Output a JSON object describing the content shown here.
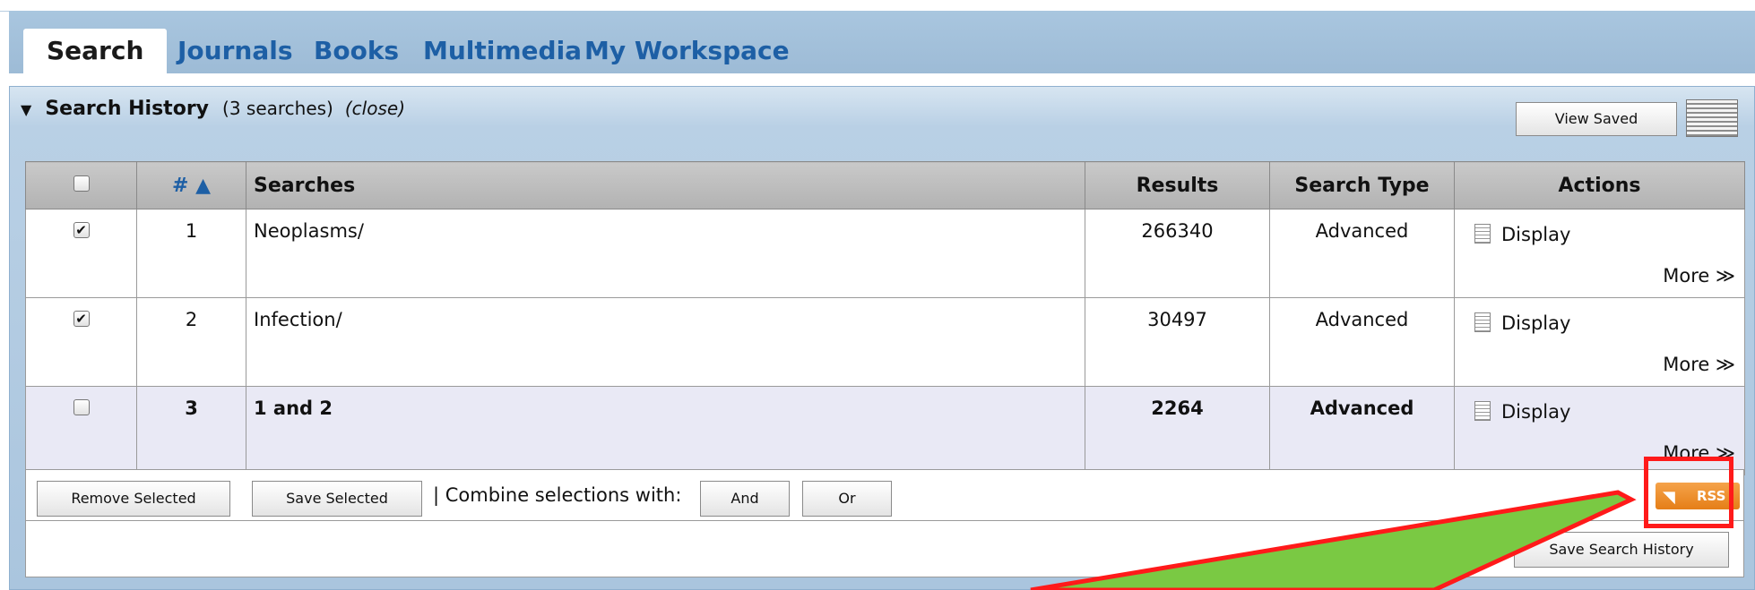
{
  "tabs": [
    {
      "label": "Search",
      "active": true
    },
    {
      "label": "Journals"
    },
    {
      "label": "Books"
    },
    {
      "label": "Multimedia"
    },
    {
      "label": "My Workspace"
    }
  ],
  "history": {
    "title": "Search History",
    "count_text": "(3 searches)",
    "close_text": "(close)",
    "view_saved_label": "View Saved"
  },
  "table": {
    "headers": {
      "num": "# ▲",
      "searches": "Searches",
      "results": "Results",
      "type": "Search Type",
      "actions": "Actions"
    },
    "rows": [
      {
        "checked": true,
        "num": "1",
        "query": "Neoplasms/",
        "results": "266340",
        "type": "Advanced",
        "display": "Display",
        "more": "More ≫"
      },
      {
        "checked": true,
        "num": "2",
        "query": "Infection/",
        "results": "30497",
        "type": "Advanced",
        "display": "Display",
        "more": "More ≫"
      },
      {
        "checked": false,
        "num": "3",
        "query": "1 and 2",
        "results": "2264",
        "type": "Advanced",
        "display": "Display",
        "more": "More ≫"
      }
    ]
  },
  "footer": {
    "remove_selected": "Remove Selected",
    "save_selected": "Save Selected",
    "combine_text": "| Combine selections with:",
    "and_label": "And",
    "or_label": "Or",
    "rss_label": "RSS",
    "save_history_label": "Save Search History"
  },
  "colors": {
    "tab_blue": "#1d5fa5",
    "panel_blue": "#aac5de",
    "highlight_red": "#ff1a1a",
    "arrow_green": "#7ac943",
    "rss_orange": "#e57e17"
  }
}
